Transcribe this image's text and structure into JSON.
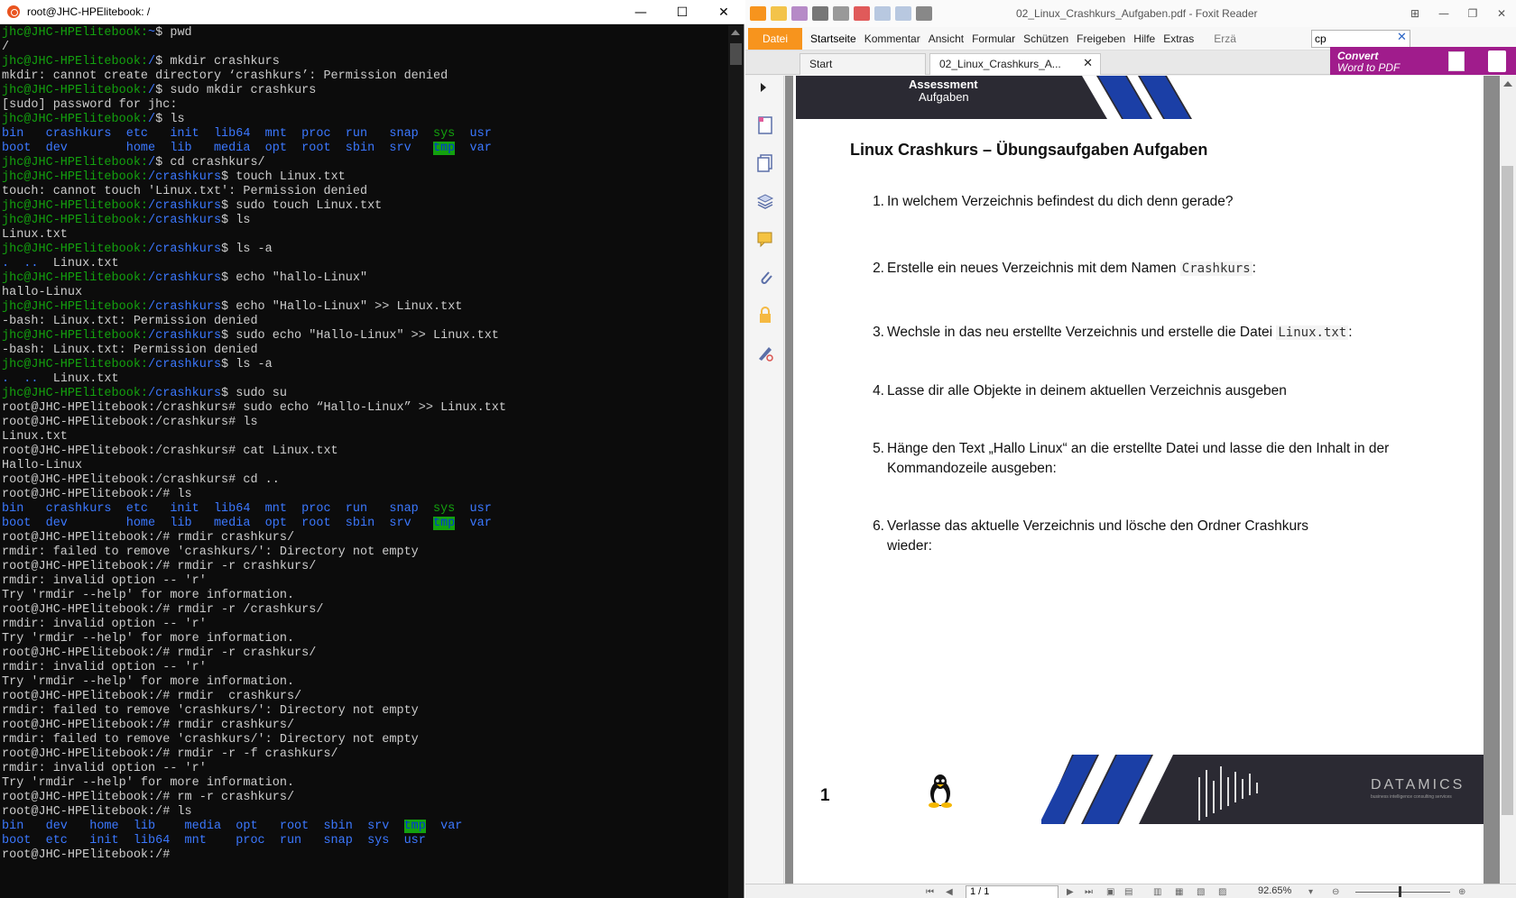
{
  "colors": {
    "term_bg": "#0c0c0c",
    "term_fg": "#cccccc",
    "prompt_green": "#13a10e",
    "dir_blue": "#3b78ff",
    "foxit_orange": "#f7941d",
    "banner_purple": "#a01c8c",
    "page_dark": "#2b2a33"
  },
  "terminal": {
    "title": "root@JHC-HPElitebook: /",
    "lines": [
      [
        {
          "t": "jhc@JHC-HPElitebook:",
          "c": "g"
        },
        {
          "t": "~",
          "c": "b"
        },
        {
          "t": "$ pwd"
        }
      ],
      [
        {
          "t": "/"
        }
      ],
      [
        {
          "t": "jhc@JHC-HPElitebook:",
          "c": "g"
        },
        {
          "t": "/",
          "c": "b"
        },
        {
          "t": "$ mkdir crashkurs"
        }
      ],
      [
        {
          "t": "mkdir: cannot create directory ‘crashkurs’: Permission denied"
        }
      ],
      [
        {
          "t": "jhc@JHC-HPElitebook:",
          "c": "g"
        },
        {
          "t": "/",
          "c": "b"
        },
        {
          "t": "$ sudo mkdir crashkurs"
        }
      ],
      [
        {
          "t": "[sudo] password for jhc:"
        }
      ],
      [
        {
          "t": "jhc@JHC-HPElitebook:",
          "c": "g"
        },
        {
          "t": "/",
          "c": "b"
        },
        {
          "t": "$ ls"
        }
      ],
      [
        {
          "t": "bin   crashkurs  etc   init  lib64  mnt  proc  run   snap  ",
          "c": "b"
        },
        {
          "t": "sys",
          "c": "g"
        },
        {
          "t": "  usr",
          "c": "b"
        }
      ],
      [
        {
          "t": "boot  dev        home  lib   media  opt  root  sbin  srv   ",
          "c": "b"
        },
        {
          "t": "tmp",
          "c": "hl"
        },
        {
          "t": "  var",
          "c": "b"
        }
      ],
      [
        {
          "t": "jhc@JHC-HPElitebook:",
          "c": "g"
        },
        {
          "t": "/",
          "c": "b"
        },
        {
          "t": "$ cd crashkurs/"
        }
      ],
      [
        {
          "t": "jhc@JHC-HPElitebook:",
          "c": "g"
        },
        {
          "t": "/crashkurs",
          "c": "b"
        },
        {
          "t": "$ touch Linux.txt"
        }
      ],
      [
        {
          "t": "touch: cannot touch 'Linux.txt': Permission denied"
        }
      ],
      [
        {
          "t": "jhc@JHC-HPElitebook:",
          "c": "g"
        },
        {
          "t": "/crashkurs",
          "c": "b"
        },
        {
          "t": "$ sudo touch Linux.txt"
        }
      ],
      [
        {
          "t": "jhc@JHC-HPElitebook:",
          "c": "g"
        },
        {
          "t": "/crashkurs",
          "c": "b"
        },
        {
          "t": "$ ls"
        }
      ],
      [
        {
          "t": "Linux.txt"
        }
      ],
      [
        {
          "t": "jhc@JHC-HPElitebook:",
          "c": "g"
        },
        {
          "t": "/crashkurs",
          "c": "b"
        },
        {
          "t": "$ ls -a"
        }
      ],
      [
        {
          "t": ".  ..",
          "c": "b"
        },
        {
          "t": "  Linux.txt"
        }
      ],
      [
        {
          "t": "jhc@JHC-HPElitebook:",
          "c": "g"
        },
        {
          "t": "/crashkurs",
          "c": "b"
        },
        {
          "t": "$ echo \"hallo-Linux\""
        }
      ],
      [
        {
          "t": "hallo-Linux"
        }
      ],
      [
        {
          "t": "jhc@JHC-HPElitebook:",
          "c": "g"
        },
        {
          "t": "/crashkurs",
          "c": "b"
        },
        {
          "t": "$ echo \"Hallo-Linux\" >> Linux.txt"
        }
      ],
      [
        {
          "t": "-bash: Linux.txt: Permission denied"
        }
      ],
      [
        {
          "t": "jhc@JHC-HPElitebook:",
          "c": "g"
        },
        {
          "t": "/crashkurs",
          "c": "b"
        },
        {
          "t": "$ sudo echo \"Hallo-Linux\" >> Linux.txt"
        }
      ],
      [
        {
          "t": "-bash: Linux.txt: Permission denied"
        }
      ],
      [
        {
          "t": "jhc@JHC-HPElitebook:",
          "c": "g"
        },
        {
          "t": "/crashkurs",
          "c": "b"
        },
        {
          "t": "$ ls -a"
        }
      ],
      [
        {
          "t": ".  ..",
          "c": "b"
        },
        {
          "t": "  Linux.txt"
        }
      ],
      [
        {
          "t": "jhc@JHC-HPElitebook:",
          "c": "g"
        },
        {
          "t": "/crashkurs",
          "c": "b"
        },
        {
          "t": "$ sudo su"
        }
      ],
      [
        {
          "t": "root@JHC-HPElitebook:/crashkurs# sudo echo “Hallo-Linux” >> Linux.txt"
        }
      ],
      [
        {
          "t": "root@JHC-HPElitebook:/crashkurs# ls"
        }
      ],
      [
        {
          "t": "Linux.txt"
        }
      ],
      [
        {
          "t": "root@JHC-HPElitebook:/crashkurs# cat Linux.txt"
        }
      ],
      [
        {
          "t": "Hallo-Linux"
        }
      ],
      [
        {
          "t": "root@JHC-HPElitebook:/crashkurs# cd .."
        }
      ],
      [
        {
          "t": "root@JHC-HPElitebook:/# ls"
        }
      ],
      [
        {
          "t": "bin   crashkurs  etc   init  lib64  mnt  proc  run   snap  ",
          "c": "b"
        },
        {
          "t": "sys",
          "c": "g"
        },
        {
          "t": "  usr",
          "c": "b"
        }
      ],
      [
        {
          "t": "boot  dev        home  lib   media  opt  root  sbin  srv   ",
          "c": "b"
        },
        {
          "t": "tmp",
          "c": "hl"
        },
        {
          "t": "  var",
          "c": "b"
        }
      ],
      [
        {
          "t": "root@JHC-HPElitebook:/# rmdir crashkurs/"
        }
      ],
      [
        {
          "t": "rmdir: failed to remove 'crashkurs/': Directory not empty"
        }
      ],
      [
        {
          "t": "root@JHC-HPElitebook:/# rmdir -r crashkurs/"
        }
      ],
      [
        {
          "t": "rmdir: invalid option -- 'r'"
        }
      ],
      [
        {
          "t": "Try 'rmdir --help' for more information."
        }
      ],
      [
        {
          "t": "root@JHC-HPElitebook:/# rmdir -r /crashkurs/"
        }
      ],
      [
        {
          "t": "rmdir: invalid option -- 'r'"
        }
      ],
      [
        {
          "t": "Try 'rmdir --help' for more information."
        }
      ],
      [
        {
          "t": "root@JHC-HPElitebook:/# rmdir -r crashkurs/"
        }
      ],
      [
        {
          "t": "rmdir: invalid option -- 'r'"
        }
      ],
      [
        {
          "t": "Try 'rmdir --help' for more information."
        }
      ],
      [
        {
          "t": "root@JHC-HPElitebook:/# rmdir  crashkurs/"
        }
      ],
      [
        {
          "t": "rmdir: failed to remove 'crashkurs/': Directory not empty"
        }
      ],
      [
        {
          "t": "root@JHC-HPElitebook:/# rmdir crashkurs/"
        }
      ],
      [
        {
          "t": "rmdir: failed to remove 'crashkurs/': Directory not empty"
        }
      ],
      [
        {
          "t": "root@JHC-HPElitebook:/# rmdir -r -f crashkurs/"
        }
      ],
      [
        {
          "t": "rmdir: invalid option -- 'r'"
        }
      ],
      [
        {
          "t": "Try 'rmdir --help' for more information."
        }
      ],
      [
        {
          "t": "root@JHC-HPElitebook:/# rm -r crashkurs/"
        }
      ],
      [
        {
          "t": "root@JHC-HPElitebook:/# ls"
        }
      ],
      [
        {
          "t": "bin   dev   home  lib    media  opt   root  sbin  srv  ",
          "c": "b"
        },
        {
          "t": "tmp",
          "c": "hl"
        },
        {
          "t": "  var",
          "c": "b"
        }
      ],
      [
        {
          "t": "boot  etc   init  lib64  mnt    proc  run   snap  sys  usr",
          "c": "b"
        }
      ],
      [
        {
          "t": "root@JHC-HPElitebook:/# "
        }
      ]
    ]
  },
  "foxit": {
    "title": "02_Linux_Crashkurs_Aufgaben.pdf - Foxit Reader",
    "file_button": "Datei",
    "menu": [
      "Startseite",
      "Kommentar",
      "Ansicht",
      "Formular",
      "Schützen",
      "Freigeben",
      "Hilfe",
      "Extras"
    ],
    "menu_extra": "Erzä",
    "search_value": "cp",
    "tabs": {
      "start": "Start",
      "doc": "02_Linux_Crashkurs_A..."
    },
    "convert": {
      "line1": "Convert",
      "line2": "Word to PDF"
    },
    "page": {
      "header_line1": "Assessment",
      "header_line2": "Aufgaben",
      "title": "Linux Crashkurs – Übungsaufgaben Aufgaben",
      "tasks": [
        {
          "num": "1.",
          "pre": "In welchem Verzeichnis befindest du dich denn gerade?",
          "code": "",
          "post": ""
        },
        {
          "num": "2.",
          "pre": "Erstelle ein neues Verzeichnis mit dem Namen ",
          "code": "Crashkurs",
          "post": ":"
        },
        {
          "num": "3.",
          "pre": "Wechsle in das neu erstellte Verzeichnis und erstelle die Datei ",
          "code": "Linux.txt",
          "post": ":"
        },
        {
          "num": "4.",
          "pre": "Lasse dir alle Objekte in deinem aktuellen Verzeichnis ausgeben",
          "code": "",
          "post": ""
        },
        {
          "num": "5.",
          "pre": "Hänge den Text „Hallo Linux“ an die erstellte Datei und lasse die den Inhalt in der Kommandozeile ausgeben:",
          "code": "",
          "post": ""
        },
        {
          "num": "6.",
          "pre": "Verlasse das aktuelle Verzeichnis und lösche den Ordner Crashkurs wieder:",
          "code": "",
          "post": ""
        }
      ],
      "page_number": "1",
      "brand": "DATAMICS",
      "brand_sub": "business intelligence consulting services"
    },
    "status": {
      "page_input": "1 / 1",
      "zoom": "92.65%"
    }
  }
}
